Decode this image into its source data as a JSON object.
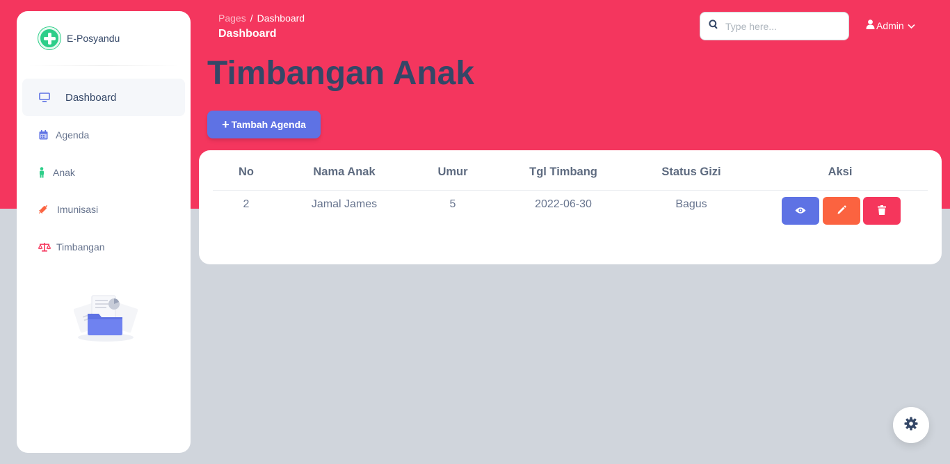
{
  "brand": {
    "name": "E-Posyandu",
    "icon": "plus-circle-icon"
  },
  "sidebar": {
    "items": [
      {
        "label": "Dashboard",
        "icon": "monitor-icon",
        "active": true
      },
      {
        "label": "Agenda",
        "icon": "calendar-icon",
        "active": false
      },
      {
        "label": "Anak",
        "icon": "child-icon",
        "active": false
      },
      {
        "label": "Imunisasi",
        "icon": "syringe-icon",
        "active": false
      },
      {
        "label": "Timbangan",
        "icon": "scale-icon",
        "active": false
      }
    ]
  },
  "header": {
    "breadcrumb": {
      "root": "Pages",
      "separator": "/",
      "current": "Dashboard"
    },
    "title": "Dashboard"
  },
  "search": {
    "placeholder": "Type here..."
  },
  "user": {
    "name": "Admin"
  },
  "page": {
    "title": "Timbangan Anak",
    "add_button_label": "Tambah Agenda"
  },
  "table": {
    "columns": [
      "No",
      "Nama Anak",
      "Umur",
      "Tgl Timbang",
      "Status Gizi",
      "Aksi"
    ],
    "rows": [
      {
        "no": "2",
        "nama": "Jamal James",
        "umur": "5",
        "tgl": "2022-06-30",
        "status": "Bagus"
      }
    ]
  },
  "colors": {
    "header_bg": "#f4365e",
    "primary": "#5e72e4",
    "warning": "#fb6340",
    "danger": "#f5365c",
    "success": "#2dce89",
    "text_dark": "#344767"
  }
}
